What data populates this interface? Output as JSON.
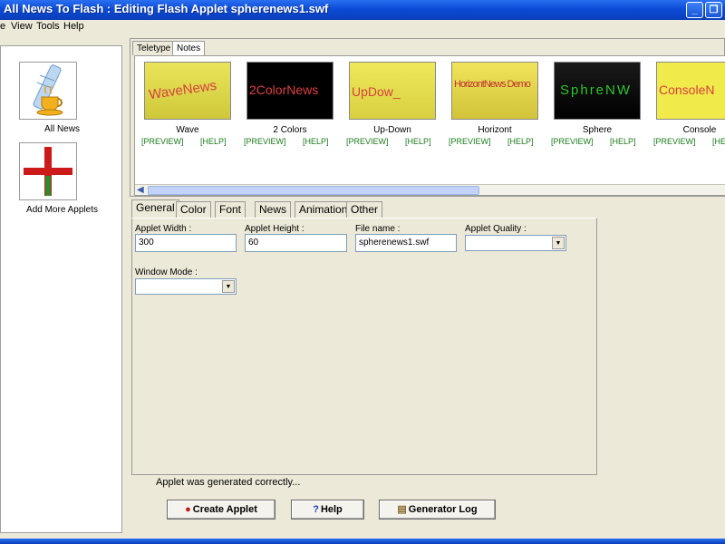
{
  "window": {
    "title": "All News To Flash : Editing Flash Applet spherenews1.swf",
    "min": "_",
    "max": "❐",
    "close": "✕"
  },
  "menu": [
    "e",
    "View",
    "Tools",
    "Help"
  ],
  "sidebar": {
    "items": [
      {
        "label": "All News",
        "icon": "coffee-news-icon"
      },
      {
        "label": "Add More Applets",
        "icon": "red-plus-icon"
      }
    ]
  },
  "gallery": {
    "tabs": [
      "Teletype",
      "Notes"
    ],
    "preview_label": "[PREVIEW]",
    "help_label": "[HELP]",
    "applets": [
      {
        "name": "Wave",
        "thumb_text": "WaveNews",
        "bg": "#d9d34a",
        "fg": "#d64040"
      },
      {
        "name": "2 Colors",
        "thumb_text": "2ColorNews",
        "bg": "#000000",
        "fg": "#e04040"
      },
      {
        "name": "Up-Down",
        "thumb_text": "UpDow_",
        "bg": "#e8e04a",
        "fg": "#d64040"
      },
      {
        "name": "Horizont",
        "thumb_text": "HorizontNews Demo",
        "bg": "#e0d84a",
        "fg": "#c03030"
      },
      {
        "name": "Sphere",
        "thumb_text": "SphreNW",
        "bg": "#0a0a0a",
        "fg": "#2ec42e"
      },
      {
        "name": "Console",
        "thumb_text": "ConsoleN",
        "bg": "#f0ea4a",
        "fg": "#d64040"
      }
    ]
  },
  "properties": {
    "tabs": [
      "General",
      "Color",
      "Font",
      "News",
      "Animation",
      "Other"
    ],
    "fields": {
      "applet_width_label": "Applet Width :",
      "applet_width_value": "300",
      "applet_height_label": "Applet Height :",
      "applet_height_value": "60",
      "file_name_label": "File name :",
      "file_name_value": "spherenews1.swf",
      "applet_quality_label": "Applet Quality :",
      "window_mode_label": "Window Mode :"
    }
  },
  "status": "Applet was generated correctly...",
  "buttons": {
    "create": "Create Applet",
    "help": "Help",
    "log": "Generator Log"
  }
}
